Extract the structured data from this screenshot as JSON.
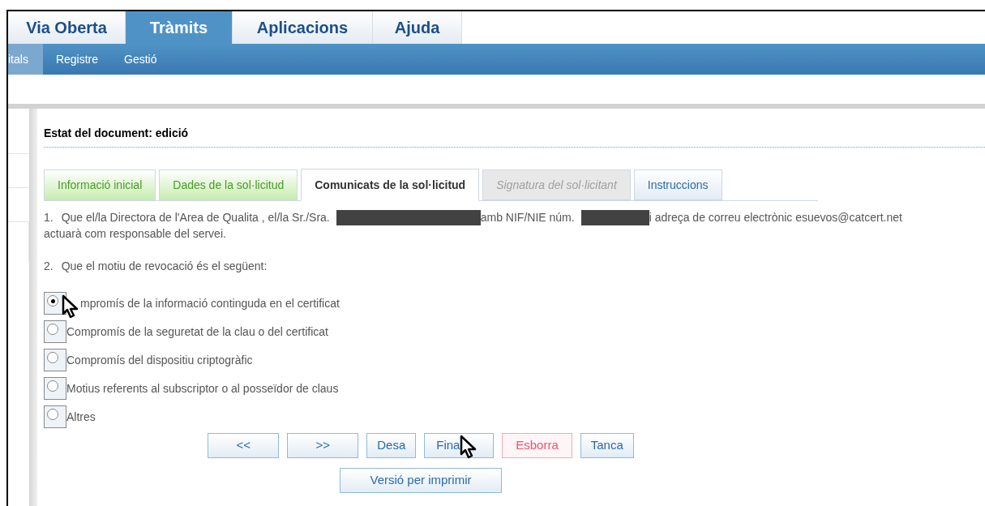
{
  "top_tabs": [
    {
      "label": "Via Oberta",
      "selected": false
    },
    {
      "label": "Tràmits",
      "selected": true
    },
    {
      "label": "Aplicacions",
      "selected": false
    },
    {
      "label": "Ajuda",
      "selected": false
    }
  ],
  "sub_nav": [
    {
      "label": "itals",
      "selected": true
    },
    {
      "label": "Registre",
      "selected": false
    },
    {
      "label": "Gestió",
      "selected": false
    }
  ],
  "document_status": "Estat del document: edició",
  "form_tabs": [
    {
      "label": "Informació inicial",
      "kind": "done",
      "selected": false
    },
    {
      "label": "Dades de la sol·licitud",
      "kind": "done",
      "selected": false
    },
    {
      "label": "Comunicats de la sol·licitud",
      "kind": "normal",
      "selected": true
    },
    {
      "label": "Signatura del sol·licitant",
      "kind": "disabled",
      "selected": false
    },
    {
      "label": "Instruccions",
      "kind": "normal",
      "selected": false
    }
  ],
  "statement_1": {
    "number": "1.",
    "before_name": "Que el/la Directora de l'Area de Qualita , el/la Sr./Sra.",
    "before_id": "amb NIF/NIE núm.",
    "after_id": "i adreça de correu electrònic esuevos@catcert.net",
    "continuation": "actuarà com responsable del servei."
  },
  "statement_2": {
    "number": "2.",
    "text": "Que el motiu de revocació és el següent:"
  },
  "reasons": [
    {
      "label": "mpromís de la informació continguda en el certificat",
      "selected": true,
      "cursor": true
    },
    {
      "label": "Compromís de la seguretat de la clau o del certificat",
      "selected": false,
      "cursor": false
    },
    {
      "label": "Compromís del dispositiu criptogràfic",
      "selected": false,
      "cursor": false
    },
    {
      "label": "Motius referents al subscriptor o al posseïdor de claus",
      "selected": false,
      "cursor": false
    },
    {
      "label": "Altres",
      "selected": false,
      "cursor": false
    }
  ],
  "buttons": [
    {
      "label": "<<",
      "kind": "wide",
      "cursor": false
    },
    {
      "label": ">>",
      "kind": "wide",
      "cursor": false
    },
    {
      "label": "Desa",
      "kind": "normal",
      "cursor": false
    },
    {
      "label": "Fina",
      "kind": "normal",
      "cursor": true
    },
    {
      "label": "Esborra",
      "kind": "danger",
      "cursor": false
    },
    {
      "label": "Tanca",
      "kind": "normal",
      "cursor": false
    }
  ],
  "print_button": "Versió per imprimir"
}
